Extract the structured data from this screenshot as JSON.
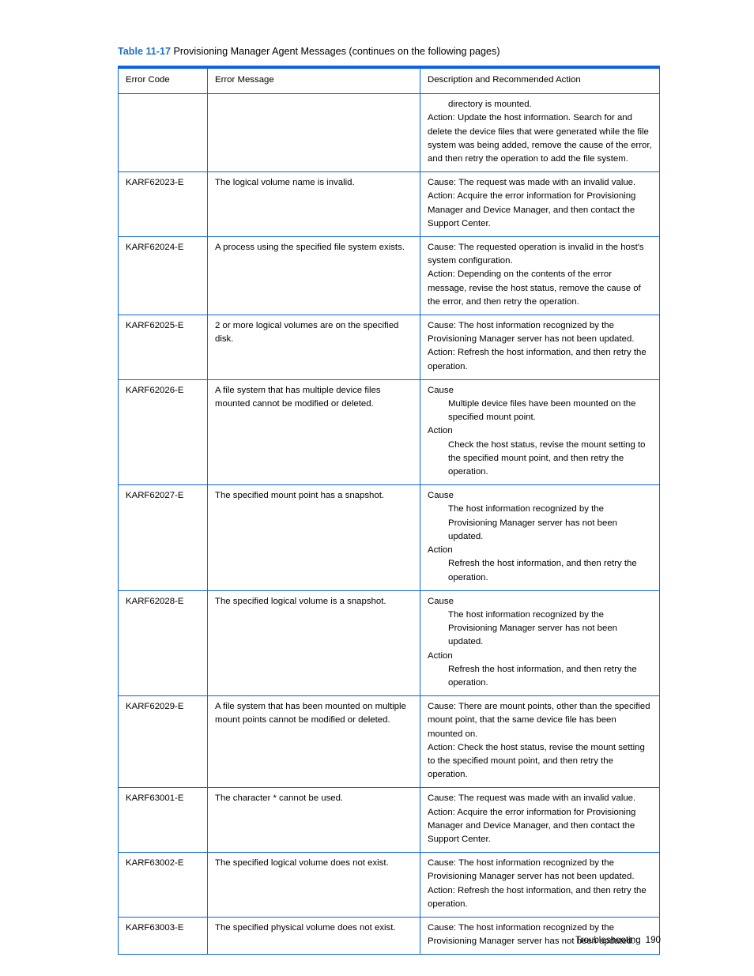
{
  "caption": {
    "number": "Table 11-17",
    "text": " Provisioning Manager Agent Messages (continues on the following pages)"
  },
  "table": {
    "headers": {
      "error_code": "Error Code",
      "error_message": "Error Message",
      "description": "Description and Recommended Action"
    },
    "rows": [
      {
        "code": "",
        "message": "",
        "desc_lines": [
          {
            "indent": true,
            "text": "directory is mounted."
          },
          {
            "indent": false,
            "text": "Action: Update the host information. Search for and delete the device files that were generated while the file system was being added, remove the cause of the error, and then retry the operation to add the file system."
          }
        ]
      },
      {
        "code": "KARF62023-E",
        "message": "The logical volume name is invalid.",
        "desc_lines": [
          {
            "indent": false,
            "text": "Cause: The request was made with an invalid value."
          },
          {
            "indent": false,
            "text": "Action: Acquire the error information for Provisioning Manager and Device Manager, and then contact the Support Center."
          }
        ]
      },
      {
        "code": "KARF62024-E",
        "message": "A process using the specified file system exists.",
        "desc_lines": [
          {
            "indent": false,
            "text": "Cause: The requested operation is invalid in the host's system configuration."
          },
          {
            "indent": false,
            "text": "Action: Depending on the contents of the error message, revise the host status, remove the cause of the error, and then retry the operation."
          }
        ]
      },
      {
        "code": "KARF62025-E",
        "message": "2 or more logical volumes are on the specified disk.",
        "desc_lines": [
          {
            "indent": false,
            "text": "Cause: The host information recognized by the Provisioning Manager server has not been updated."
          },
          {
            "indent": false,
            "text": "Action: Refresh the host information, and then retry the operation."
          }
        ]
      },
      {
        "code": "KARF62026-E",
        "message": "A file system that has multiple device files mounted cannot be modified or deleted.",
        "desc_lines": [
          {
            "indent": false,
            "text": "Cause"
          },
          {
            "indent": true,
            "text": "Multiple device files have been mounted on the specified mount point."
          },
          {
            "indent": false,
            "text": "Action"
          },
          {
            "indent": true,
            "text": "Check the host status, revise the mount setting to the specified mount point, and then retry the operation."
          }
        ]
      },
      {
        "code": "KARF62027-E",
        "message": "The specified mount point has a snapshot.",
        "desc_lines": [
          {
            "indent": false,
            "text": "Cause"
          },
          {
            "indent": true,
            "text": "The host information recognized by the Provisioning Manager server has not been updated."
          },
          {
            "indent": false,
            "text": "Action"
          },
          {
            "indent": true,
            "text": "Refresh the host information, and then retry the operation."
          }
        ]
      },
      {
        "code": "KARF62028-E",
        "message": "The specified logical volume is a snapshot.",
        "desc_lines": [
          {
            "indent": false,
            "text": "Cause"
          },
          {
            "indent": true,
            "text": "The host information recognized by the Provisioning Manager server has not been updated."
          },
          {
            "indent": false,
            "text": "Action"
          },
          {
            "indent": true,
            "text": "Refresh the host information, and then retry the operation."
          }
        ]
      },
      {
        "code": "KARF62029-E",
        "message": "A file system that has been mounted on multiple mount points cannot be modified or deleted.",
        "desc_lines": [
          {
            "indent": false,
            "text": "Cause: There are mount points, other than the specified mount point, that the same device file has been mounted on."
          },
          {
            "indent": false,
            "text": "Action: Check the host status, revise the mount setting to the specified mount point, and then retry the operation."
          }
        ]
      },
      {
        "code": "KARF63001-E",
        "message": "The character * cannot be used.",
        "desc_lines": [
          {
            "indent": false,
            "text": "Cause: The request was made with an invalid value."
          },
          {
            "indent": false,
            "text": "Action: Acquire the error information for Provisioning Manager and Device Manager, and then contact the Support Center."
          }
        ]
      },
      {
        "code": "KARF63002-E",
        "message": "The specified logical volume does not exist.",
        "desc_lines": [
          {
            "indent": false,
            "text": "Cause: The host information recognized by the Provisioning Manager server has not been updated."
          },
          {
            "indent": false,
            "text": "Action: Refresh the host information, and then retry the operation."
          }
        ]
      },
      {
        "code": "KARF63003-E",
        "message": "The specified physical volume does not exist.",
        "desc_lines": [
          {
            "indent": false,
            "text": "Cause: The host information recognized by the Provisioning Manager server has not been updated."
          }
        ]
      }
    ]
  },
  "footer": {
    "chapter": "Troubleshooting",
    "page_number": "190"
  },
  "colors": {
    "table_border": "#0b63e5",
    "caption_accent": "#1f6fd0",
    "text": "#000000"
  }
}
